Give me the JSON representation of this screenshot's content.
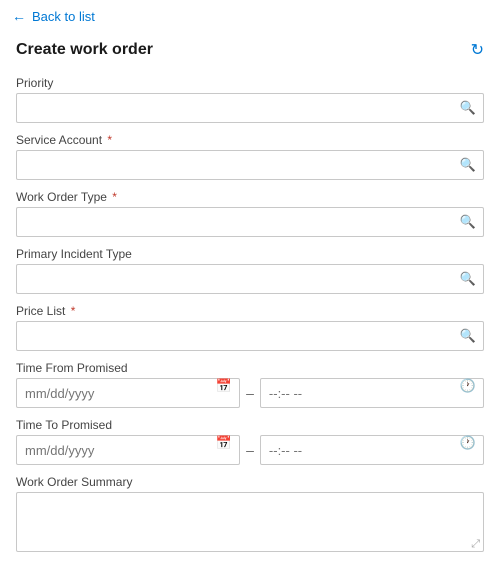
{
  "back_link": {
    "arrow": "←",
    "label": "Back to list"
  },
  "page": {
    "title": "Create work order",
    "refresh_icon": "↻"
  },
  "form": {
    "fields": [
      {
        "id": "priority",
        "label": "Priority",
        "required": false,
        "type": "search",
        "placeholder": ""
      },
      {
        "id": "service-account",
        "label": "Service Account",
        "required": true,
        "type": "search",
        "placeholder": ""
      },
      {
        "id": "work-order-type",
        "label": "Work Order Type",
        "required": true,
        "type": "search",
        "placeholder": ""
      },
      {
        "id": "primary-incident-type",
        "label": "Primary Incident Type",
        "required": false,
        "type": "search",
        "placeholder": ""
      },
      {
        "id": "price-list",
        "label": "Price List",
        "required": true,
        "type": "search",
        "placeholder": ""
      }
    ],
    "time_from": {
      "label": "Time From Promised",
      "date_placeholder": "mm/dd/yyyy",
      "time_placeholder": "--:-- --"
    },
    "time_to": {
      "label": "Time To Promised",
      "date_placeholder": "mm/dd/yyyy",
      "time_placeholder": "--:-- --"
    },
    "summary": {
      "label": "Work Order Summary"
    }
  }
}
